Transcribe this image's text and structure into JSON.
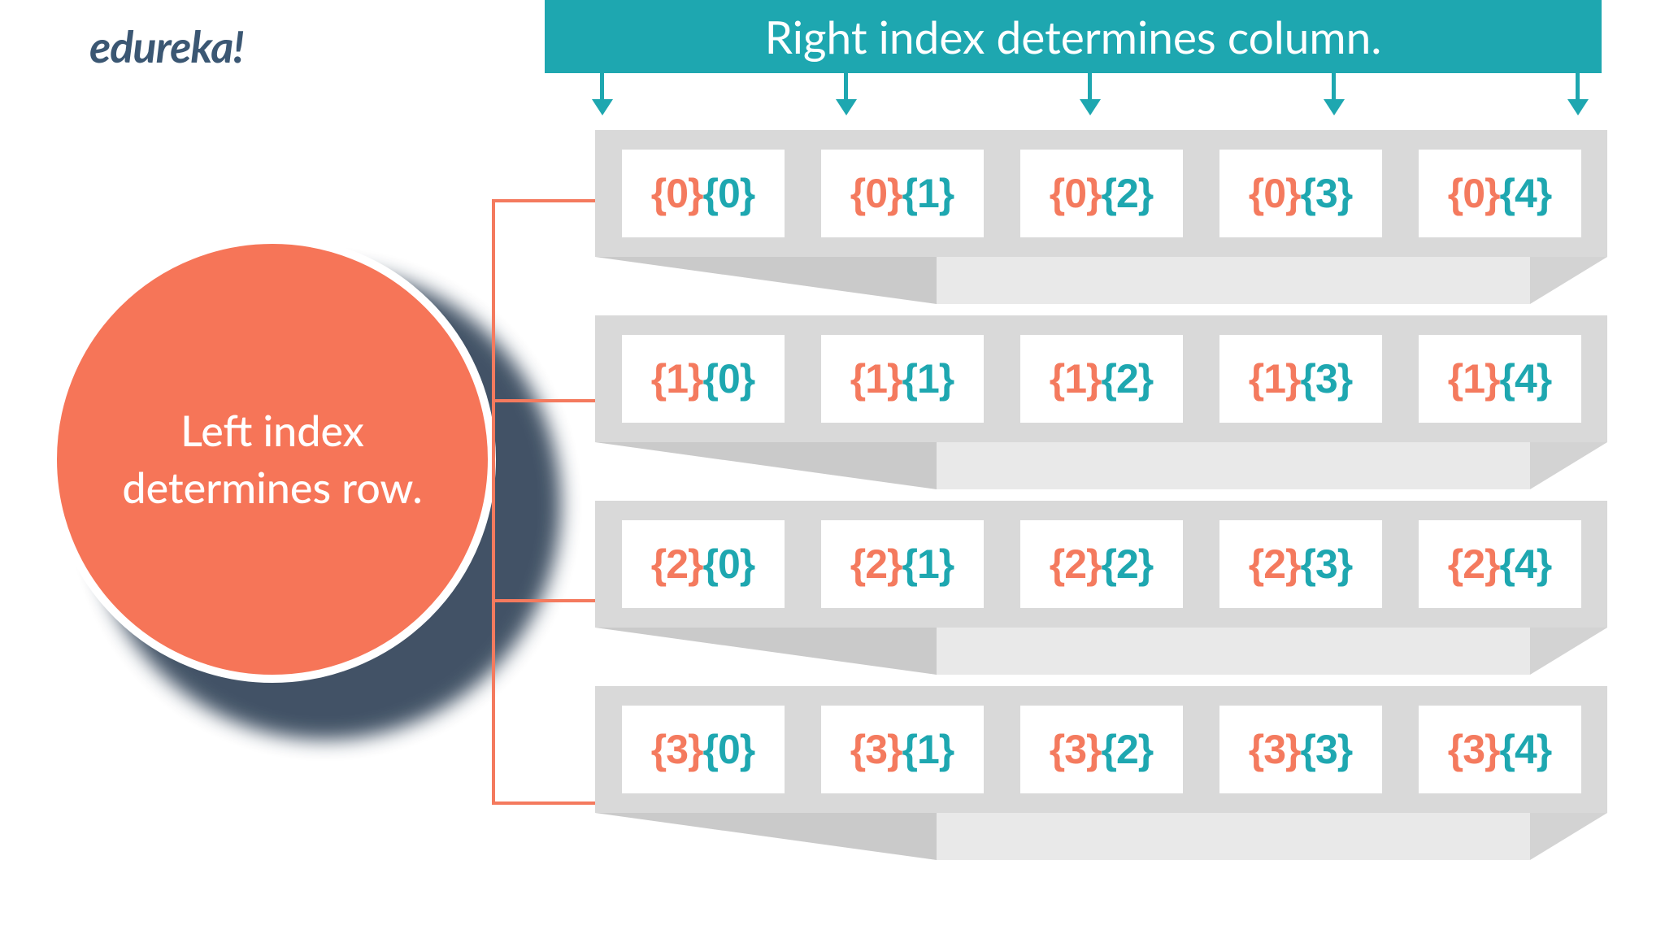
{
  "brand": "edureka!",
  "header": "Right index determines column.",
  "circle_text": "Left index\ndetermines row.",
  "colors": {
    "teal": "#1ea7b0",
    "orange": "#f47a5e",
    "navy": "#132840",
    "grey": "#d9d9d9",
    "white": "#ffffff"
  },
  "dimensions": {
    "rows": 4,
    "cols": 5
  },
  "grid": [
    [
      {
        "left": "{0}",
        "right": "{0}"
      },
      {
        "left": "{0}",
        "right": "{1}"
      },
      {
        "left": "{0}",
        "right": "{2}"
      },
      {
        "left": "{0}",
        "right": "{3}"
      },
      {
        "left": "{0}",
        "right": "{4}"
      }
    ],
    [
      {
        "left": "{1}",
        "right": "{0}"
      },
      {
        "left": "{1}",
        "right": "{1}"
      },
      {
        "left": "{1}",
        "right": "{2}"
      },
      {
        "left": "{1}",
        "right": "{3}"
      },
      {
        "left": "{1}",
        "right": "{4}"
      }
    ],
    [
      {
        "left": "{2}",
        "right": "{0}"
      },
      {
        "left": "{2}",
        "right": "{1}"
      },
      {
        "left": "{2}",
        "right": "{2}"
      },
      {
        "left": "{2}",
        "right": "{3}"
      },
      {
        "left": "{2}",
        "right": "{4}"
      }
    ],
    [
      {
        "left": "{3}",
        "right": "{0}"
      },
      {
        "left": "{3}",
        "right": "{1}"
      },
      {
        "left": "{3}",
        "right": "{2}"
      },
      {
        "left": "{3}",
        "right": "{3}"
      },
      {
        "left": "{3}",
        "right": "{4}"
      }
    ]
  ]
}
